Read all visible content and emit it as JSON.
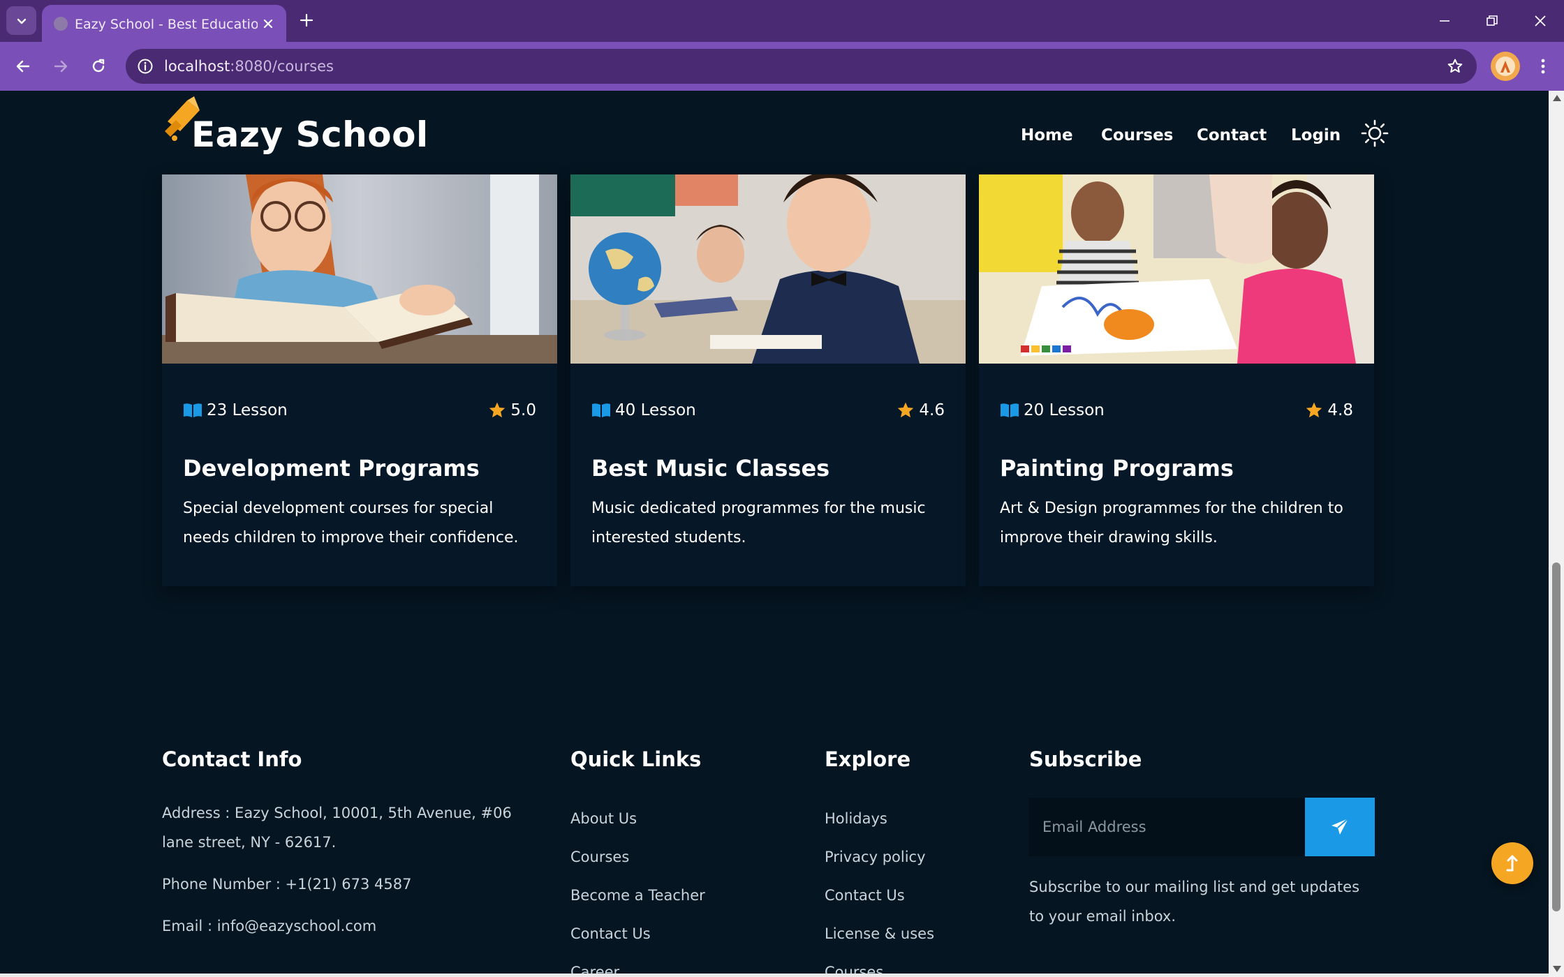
{
  "browser": {
    "tab_title": "Eazy School - Best Educational I",
    "url_host": "localhost",
    "url_rest": ":8080/courses"
  },
  "site": {
    "logo_text": "Eazy School",
    "nav": [
      "Home",
      "Courses",
      "Contact",
      "Login"
    ]
  },
  "courses": [
    {
      "lessons": "23 Lesson",
      "rating": "5.0",
      "title": "Development Programs",
      "description": "Special development courses for special needs children to improve their confidence."
    },
    {
      "lessons": "40 Lesson",
      "rating": "4.6",
      "title": "Best Music Classes",
      "description": "Music dedicated programmes for the music interested students."
    },
    {
      "lessons": "20 Lesson",
      "rating": "4.8",
      "title": "Painting Programs",
      "description": "Art & Design programmes for the children to improve their drawing skills."
    }
  ],
  "footer": {
    "contact": {
      "heading": "Contact Info",
      "address": "Address : Eazy School, 10001, 5th Avenue, #06 lane street, NY - 62617.",
      "phone": "Phone Number : +1(21) 673 4587",
      "email": "Email : info@eazyschool.com"
    },
    "quick_links": {
      "heading": "Quick Links",
      "items": [
        "About Us",
        "Courses",
        "Become a Teacher",
        "Contact Us",
        "Career"
      ]
    },
    "explore": {
      "heading": "Explore",
      "items": [
        "Holidays",
        "Privacy policy",
        "Contact Us",
        "License & uses",
        "Courses"
      ]
    },
    "subscribe": {
      "heading": "Subscribe",
      "placeholder": "Email Address",
      "text": "Subscribe to our mailing list and get updates to your email inbox."
    }
  },
  "colors": {
    "page_bg": "#051521",
    "accent_orange": "#f5a623",
    "accent_blue": "#1a9ae6",
    "browser_purple": "#7b4fb8"
  },
  "icons": [
    "tab-search-icon",
    "close-icon",
    "plus-icon",
    "minimize-icon",
    "restore-icon",
    "back-arrow-icon",
    "forward-arrow-icon",
    "reload-icon",
    "site-info-icon",
    "bookmark-star-icon",
    "profile-avatar-icon",
    "kebab-menu-icon",
    "graduation-cap-icon",
    "sun-icon",
    "book-icon",
    "star-icon",
    "send-icon",
    "arrow-up-icon"
  ]
}
